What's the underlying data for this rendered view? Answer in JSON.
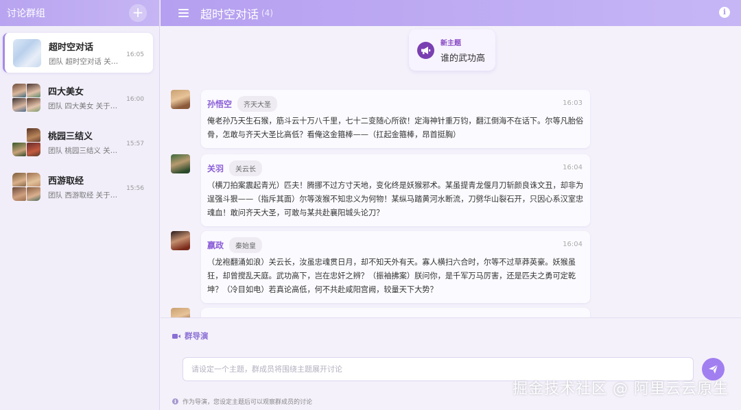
{
  "sidebar": {
    "title": "讨论群组",
    "add_icon": "plus-icon",
    "groups": [
      {
        "name": "超时空对话",
        "preview": "团队 超时空对话 关…",
        "time": "16:05",
        "active": true
      },
      {
        "name": "四大美女",
        "preview": "团队 四大美女 关于…",
        "time": "16:00",
        "active": false
      },
      {
        "name": "桃园三结义",
        "preview": "团队 桃园三结义 关…",
        "time": "15:57",
        "active": false
      },
      {
        "name": "西游取经",
        "preview": "团队 西游取经 关于…",
        "time": "15:56",
        "active": false
      }
    ]
  },
  "header": {
    "title": "超时空对话",
    "count": "(4)",
    "menu_icon": "menu-icon",
    "info_icon": "info-icon"
  },
  "topic": {
    "label": "新主题",
    "value": "谁的武功高",
    "icon": "megaphone-icon"
  },
  "messages": [
    {
      "name": "孙悟空",
      "role": "齐天大圣",
      "time": "16:03",
      "text": "俺老孙乃天生石猴，筋斗云十万八千里，七十二变随心所欲！定海神针重万钧，翻江倒海不在话下。尔等凡胎俗骨，怎敢与齐天大圣比高低？看俺这金箍棒——（扛起金箍棒，昂首挺胸）"
    },
    {
      "name": "关羽",
      "role": "关云长",
      "time": "16:04",
      "text": "（横刀拍案震起青光）匹夫！腾挪不过方寸天地，变化终是妖猴邪术。某虽提青龙偃月刀斩颜良诛文丑，却非为逞强斗狠——（指斥其面）尔等泼猴不知忠义为何物！某纵马踏黄河水断流，刀劈华山裂石开，只因心系汉室忠魂血！敢问齐天大圣，可敢与某共赴襄阳城头论刀？"
    },
    {
      "name": "嬴政",
      "role": "秦始皇",
      "time": "16:04",
      "text": "（龙袍翻涌如浪）关云长，汝虽忠魂贯日月，却不知天外有天。寡人横扫六合时，尔等不过草莽英豪。妖猴虽狂，却曾搅乱天庭。武功高下，岂在忠奸之辨？（振袖拂案）朕问你，是千军万马厉害，还是匹夫之勇可定乾坤？（冷目如电）若真论高低，何不共赴咸阳宫阙，较量天下大势？"
    }
  ],
  "director": {
    "label": "群导演",
    "icon": "video-camera-icon",
    "placeholder": "请设定一个主题，群成员将围绕主题展开讨论",
    "send_icon": "send-icon",
    "hint": "作为导演，您设定主题后可以观察群成员的讨论"
  },
  "watermark": "掘金技术社区 @ 阿里云云原生",
  "colors": {
    "accent": "#a27ff0",
    "header": "#b8a4f0",
    "name": "#8b5ed8"
  }
}
